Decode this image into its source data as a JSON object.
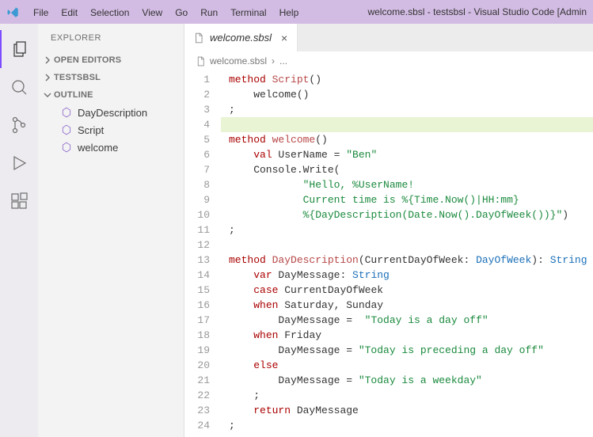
{
  "titleBar": {
    "title": "welcome.sbsl - testsbsl - Visual Studio Code [Admin",
    "menu": [
      "File",
      "Edit",
      "Selection",
      "View",
      "Go",
      "Run",
      "Terminal",
      "Help"
    ]
  },
  "activity": {
    "icons": [
      "explorer-icon",
      "search-icon",
      "source-control-icon",
      "run-debug-icon",
      "extensions-icon"
    ]
  },
  "sidebar": {
    "title": "EXPLORER",
    "sections": [
      {
        "label": "OPEN EDITORS",
        "expanded": false
      },
      {
        "label": "TESTSBSL",
        "expanded": false
      },
      {
        "label": "OUTLINE",
        "expanded": true,
        "items": [
          "DayDescription",
          "Script",
          "welcome"
        ]
      }
    ]
  },
  "tabs": {
    "active": {
      "label": "welcome.sbsl"
    }
  },
  "breadcrumb": {
    "file": "welcome.sbsl",
    "sep": "›",
    "rest": "..."
  },
  "code": {
    "lines": [
      {
        "n": 1,
        "seg": [
          [
            "kw",
            "method "
          ],
          [
            "fn",
            "Script"
          ],
          [
            "punc",
            "()"
          ]
        ]
      },
      {
        "n": 2,
        "seg": [
          [
            "id",
            "    welcome()"
          ]
        ]
      },
      {
        "n": 3,
        "seg": [
          [
            "punc",
            ";"
          ]
        ]
      },
      {
        "n": 4,
        "seg": [],
        "hl": true
      },
      {
        "n": 5,
        "seg": [
          [
            "kw",
            "method "
          ],
          [
            "fn",
            "welcome"
          ],
          [
            "punc",
            "()"
          ]
        ]
      },
      {
        "n": 6,
        "seg": [
          [
            "id",
            "    "
          ],
          [
            "kw",
            "val"
          ],
          [
            "id",
            " UserName = "
          ],
          [
            "str",
            "\"Ben\""
          ]
        ]
      },
      {
        "n": 7,
        "seg": [
          [
            "id",
            "    Console.Write("
          ]
        ]
      },
      {
        "n": 8,
        "seg": [
          [
            "id",
            "            "
          ],
          [
            "str",
            "\"Hello, %UserName!"
          ]
        ]
      },
      {
        "n": 9,
        "seg": [
          [
            "id",
            "            "
          ],
          [
            "str",
            "Current time is %{Time.Now()|HH:mm}"
          ]
        ]
      },
      {
        "n": 10,
        "seg": [
          [
            "id",
            "            "
          ],
          [
            "str",
            "%{DayDescription(Date.Now().DayOfWeek())}\""
          ],
          [
            "punc",
            ")"
          ]
        ]
      },
      {
        "n": 11,
        "seg": [
          [
            "punc",
            ";"
          ]
        ]
      },
      {
        "n": 12,
        "seg": []
      },
      {
        "n": 13,
        "seg": [
          [
            "kw",
            "method "
          ],
          [
            "fn",
            "DayDescription"
          ],
          [
            "punc",
            "(CurrentDayOfWeek: "
          ],
          [
            "type",
            "DayOfWeek"
          ],
          [
            "punc",
            "): "
          ],
          [
            "type",
            "String"
          ]
        ]
      },
      {
        "n": 14,
        "seg": [
          [
            "id",
            "    "
          ],
          [
            "kw",
            "var"
          ],
          [
            "id",
            " DayMessage: "
          ],
          [
            "type",
            "String"
          ]
        ]
      },
      {
        "n": 15,
        "seg": [
          [
            "id",
            "    "
          ],
          [
            "kw",
            "case"
          ],
          [
            "id",
            " CurrentDayOfWeek"
          ]
        ]
      },
      {
        "n": 16,
        "seg": [
          [
            "id",
            "    "
          ],
          [
            "kw",
            "when"
          ],
          [
            "id",
            " Saturday, Sunday"
          ]
        ]
      },
      {
        "n": 17,
        "seg": [
          [
            "id",
            "        DayMessage =  "
          ],
          [
            "str",
            "\"Today is a day off\""
          ]
        ]
      },
      {
        "n": 18,
        "seg": [
          [
            "id",
            "    "
          ],
          [
            "kw",
            "when"
          ],
          [
            "id",
            " Friday"
          ]
        ]
      },
      {
        "n": 19,
        "seg": [
          [
            "id",
            "        DayMessage = "
          ],
          [
            "str",
            "\"Today is preceding a day off\""
          ]
        ]
      },
      {
        "n": 20,
        "seg": [
          [
            "id",
            "    "
          ],
          [
            "kw",
            "else"
          ]
        ]
      },
      {
        "n": 21,
        "seg": [
          [
            "id",
            "        DayMessage = "
          ],
          [
            "str",
            "\"Today is a weekday\""
          ]
        ]
      },
      {
        "n": 22,
        "seg": [
          [
            "id",
            "    ;"
          ]
        ]
      },
      {
        "n": 23,
        "seg": [
          [
            "id",
            "    "
          ],
          [
            "kw",
            "return"
          ],
          [
            "id",
            " DayMessage"
          ]
        ]
      },
      {
        "n": 24,
        "seg": [
          [
            "punc",
            ";"
          ]
        ]
      }
    ]
  }
}
